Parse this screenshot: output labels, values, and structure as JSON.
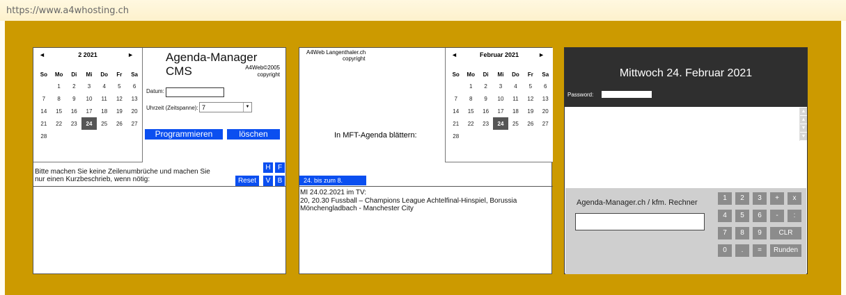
{
  "browser": {
    "url": "https://www.a4whosting.ch"
  },
  "left": {
    "calendar": {
      "prev": "◄",
      "next": "►",
      "title": "2 2021",
      "weekdays": [
        "So",
        "Mo",
        "Di",
        "Mi",
        "Do",
        "Fr",
        "Sa"
      ],
      "weeks": [
        [
          "",
          "1",
          "2",
          "3",
          "4",
          "5",
          "6"
        ],
        [
          "7",
          "8",
          "9",
          "10",
          "11",
          "12",
          "13"
        ],
        [
          "14",
          "15",
          "16",
          "17",
          "18",
          "19",
          "20"
        ],
        [
          "21",
          "22",
          "23",
          "24",
          "25",
          "26",
          "27"
        ],
        [
          "28",
          "",
          "",
          "",
          "",
          "",
          ""
        ]
      ],
      "today": "24"
    },
    "title": "Agenda-Manager CMS",
    "copyright_line1": "A4Web©2005",
    "copyright_line2": "copyright",
    "date_label": "Datum:",
    "date_value": "",
    "time_label": "Uhrzeit  (Zeitspanne):",
    "time_value": "7",
    "program_button": "Programmieren",
    "delete_button": "löschen",
    "note_line1": "Bitte machen Sie keine Zeilenumbrüche und machen Sie",
    "note_line2": "nur einen Kurzbeschrieb, wenn nötig:",
    "btn_h": "H",
    "btn_f": "F",
    "btn_reset": "Reset",
    "btn_v": "V",
    "btn_b": "B"
  },
  "middle": {
    "copy_line1": "A4Web Langenthaler.ch",
    "copy_line2": "copyright",
    "browse_label": "In MFT-Agenda blättern:",
    "calendar": {
      "prev": "◄",
      "next": "►",
      "title": "Februar 2021",
      "weekdays": [
        "So",
        "Mo",
        "Di",
        "Mi",
        "Do",
        "Fr",
        "Sa"
      ],
      "weeks": [
        [
          "",
          "1",
          "2",
          "3",
          "4",
          "5",
          "6"
        ],
        [
          "7",
          "8",
          "9",
          "10",
          "11",
          "12",
          "13"
        ],
        [
          "14",
          "15",
          "16",
          "17",
          "18",
          "19",
          "20"
        ],
        [
          "21",
          "22",
          "23",
          "24",
          "25",
          "26",
          "27"
        ],
        [
          "28",
          "",
          "",
          "",
          "",
          "",
          ""
        ]
      ],
      "today": "24"
    },
    "week_button": "24. bis zum 8.",
    "tv_line1": "MI 24.02.2021 im TV:",
    "tv_line2": "20, 20.30 Fussball – Champions League Achtelfinal-Hinspiel, Borussia",
    "tv_line3": "Mönchengladbach - Manchester City"
  },
  "right": {
    "date": "Mittwoch 24. Februar 2021",
    "password_label": "Password:",
    "calc_title": "Agenda-Manager.ch / kfm. Rechner",
    "keys": [
      [
        "1",
        "2",
        "3",
        "+",
        "x"
      ],
      [
        "4",
        "5",
        "6",
        "-",
        ":"
      ],
      [
        "7",
        "8",
        "9",
        "CLR"
      ],
      [
        "0",
        ".",
        "=",
        "Runden"
      ]
    ]
  },
  "colors": {
    "stage": "#cc9a00",
    "button_blue": "#0b4ff0",
    "dark_header": "#2f2f2f",
    "calc_bg": "#cfcfcf",
    "key": "#8c8c8c"
  }
}
